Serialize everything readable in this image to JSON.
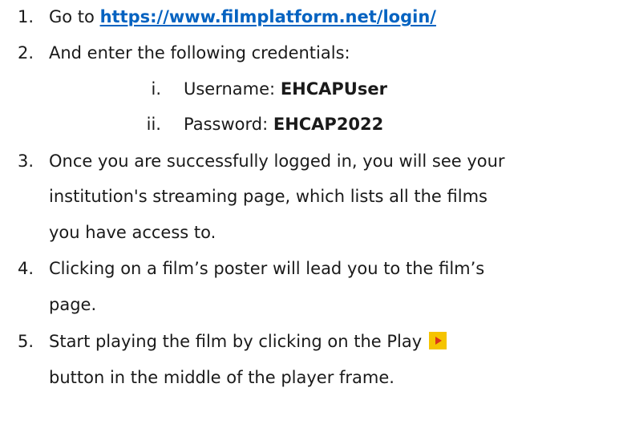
{
  "steps": [
    {
      "num": "1.",
      "prefix": "Go to ",
      "link": "https://www.filmplatform.net/login/"
    },
    {
      "num": "2.",
      "text": "And enter the following credentials:"
    },
    {
      "num": "3.",
      "lines": [
        "Once you are successfully logged in, you will see your",
        "institution's streaming page, which lists all the  films",
        "you have access to."
      ]
    },
    {
      "num": "4.",
      "lines": [
        "Clicking on a film’s poster will lead you to the film’s",
        "page."
      ]
    },
    {
      "num": "5.",
      "line1": "Start playing the film by clicking on the Play ",
      "line2": "button in the middle of the player frame.",
      "icon": "play-icon"
    }
  ],
  "credentials": [
    {
      "num": "i.",
      "label": "Username: ",
      "value": "EHCAPUser"
    },
    {
      "num": "ii.",
      "label": "Password: ",
      "value": "EHCAP2022"
    }
  ],
  "colors": {
    "link": "#0563c1",
    "play_icon_bg": "#f5c400",
    "play_icon_arrow": "#d9341a"
  }
}
